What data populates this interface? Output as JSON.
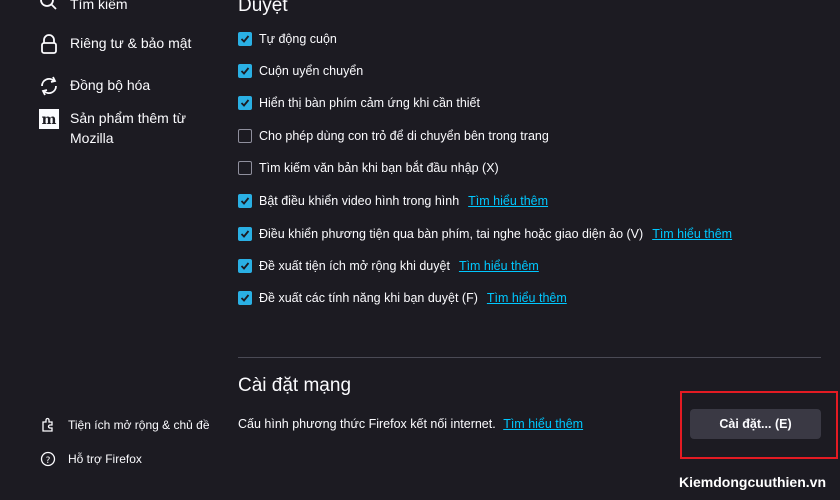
{
  "sidebar": {
    "items": [
      {
        "label": "Tìm kiếm",
        "icon": "search-icon"
      },
      {
        "label": "Riêng tư & bảo mật",
        "icon": "lock-icon"
      },
      {
        "label": "Đồng bộ hóa",
        "icon": "sync-icon"
      },
      {
        "label": "Sản phẩm thêm từ Mozilla",
        "icon": "mozilla-icon"
      }
    ],
    "footer": [
      {
        "label": "Tiện ích mở rộng & chủ đề",
        "icon": "puzzle-icon"
      },
      {
        "label": "Hỗ trợ Firefox",
        "icon": "help-icon"
      }
    ]
  },
  "browsing": {
    "title": "Duyệt",
    "options": [
      {
        "label": "Tự động cuộn",
        "checked": true
      },
      {
        "label": "Cuộn uyển chuyển",
        "checked": true
      },
      {
        "label": "Hiển thị bàn phím cảm ứng khi cần thiết",
        "checked": true
      },
      {
        "label": "Cho phép dùng con trỏ để di chuyển bên trong trang",
        "checked": false
      },
      {
        "label": "Tìm kiếm văn bản khi bạn bắt đầu nhập (X)",
        "checked": false
      },
      {
        "label": "Bật điều khiển video hình trong hình",
        "checked": true,
        "link": "Tìm hiểu thêm"
      },
      {
        "label": "Điều khiển phương tiện qua bàn phím, tai nghe hoặc giao diện ảo (V)",
        "checked": true,
        "link": "Tìm hiểu thêm"
      },
      {
        "label": "Đề xuất tiện ích mở rộng khi duyệt",
        "checked": true,
        "link": "Tìm hiểu thêm"
      },
      {
        "label": "Đề xuất các tính năng khi bạn duyệt (F)",
        "checked": true,
        "link": "Tìm hiểu thêm"
      }
    ]
  },
  "network": {
    "title": "Cài đặt mạng",
    "description": "Cấu hình phương thức Firefox kết nối internet.",
    "link": "Tìm hiểu thêm",
    "button_label": "Cài đặt... (E)"
  },
  "watermark": "Kiemdongcuuthien.vn",
  "colors": {
    "background": "#1c1b22",
    "accent": "#2ab0e4",
    "link": "#00c8ff",
    "highlight": "#e31b23"
  }
}
